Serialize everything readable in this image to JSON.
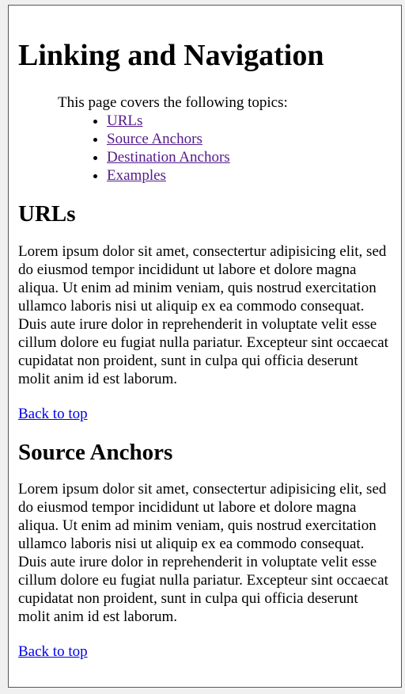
{
  "page": {
    "title": "Linking and Navigation",
    "toc_intro": "This page covers the following topics:",
    "toc": [
      {
        "label": "URLs"
      },
      {
        "label": "Source Anchors"
      },
      {
        "label": "Destination Anchors"
      },
      {
        "label": "Examples"
      }
    ],
    "sections": [
      {
        "heading": "URLs",
        "body": "Lorem ipsum dolor sit amet, consectertur adipisicing elit, sed do eiusmod tempor incididunt ut labore et dolore magna aliqua. Ut enim ad minim veniam, quis nostrud exercitation ullamco laboris nisi ut aliquip ex ea commodo consequat. Duis aute irure dolor in reprehenderit in voluptate velit esse cillum dolore eu fugiat nulla pariatur. Excepteur sint occaecat cupidatat non proident, sunt in culpa qui officia deserunt molit anim id est laborum.",
        "back_link": "Back to top"
      },
      {
        "heading": "Source Anchors",
        "body": "Lorem ipsum dolor sit amet, consectertur adipisicing elit, sed do eiusmod tempor incididunt ut labore et dolore magna aliqua. Ut enim ad minim veniam, quis nostrud exercitation ullamco laboris nisi ut aliquip ex ea commodo consequat. Duis aute irure dolor in reprehenderit in voluptate velit esse cillum dolore eu fugiat nulla pariatur. Excepteur sint occaecat cupidatat non proident, sunt in culpa qui officia deserunt molit anim id est laborum.",
        "back_link": "Back to top"
      }
    ]
  },
  "colors": {
    "visited_link": "#551a8b",
    "link": "#0000ee",
    "page_bg": "#ffffff"
  }
}
